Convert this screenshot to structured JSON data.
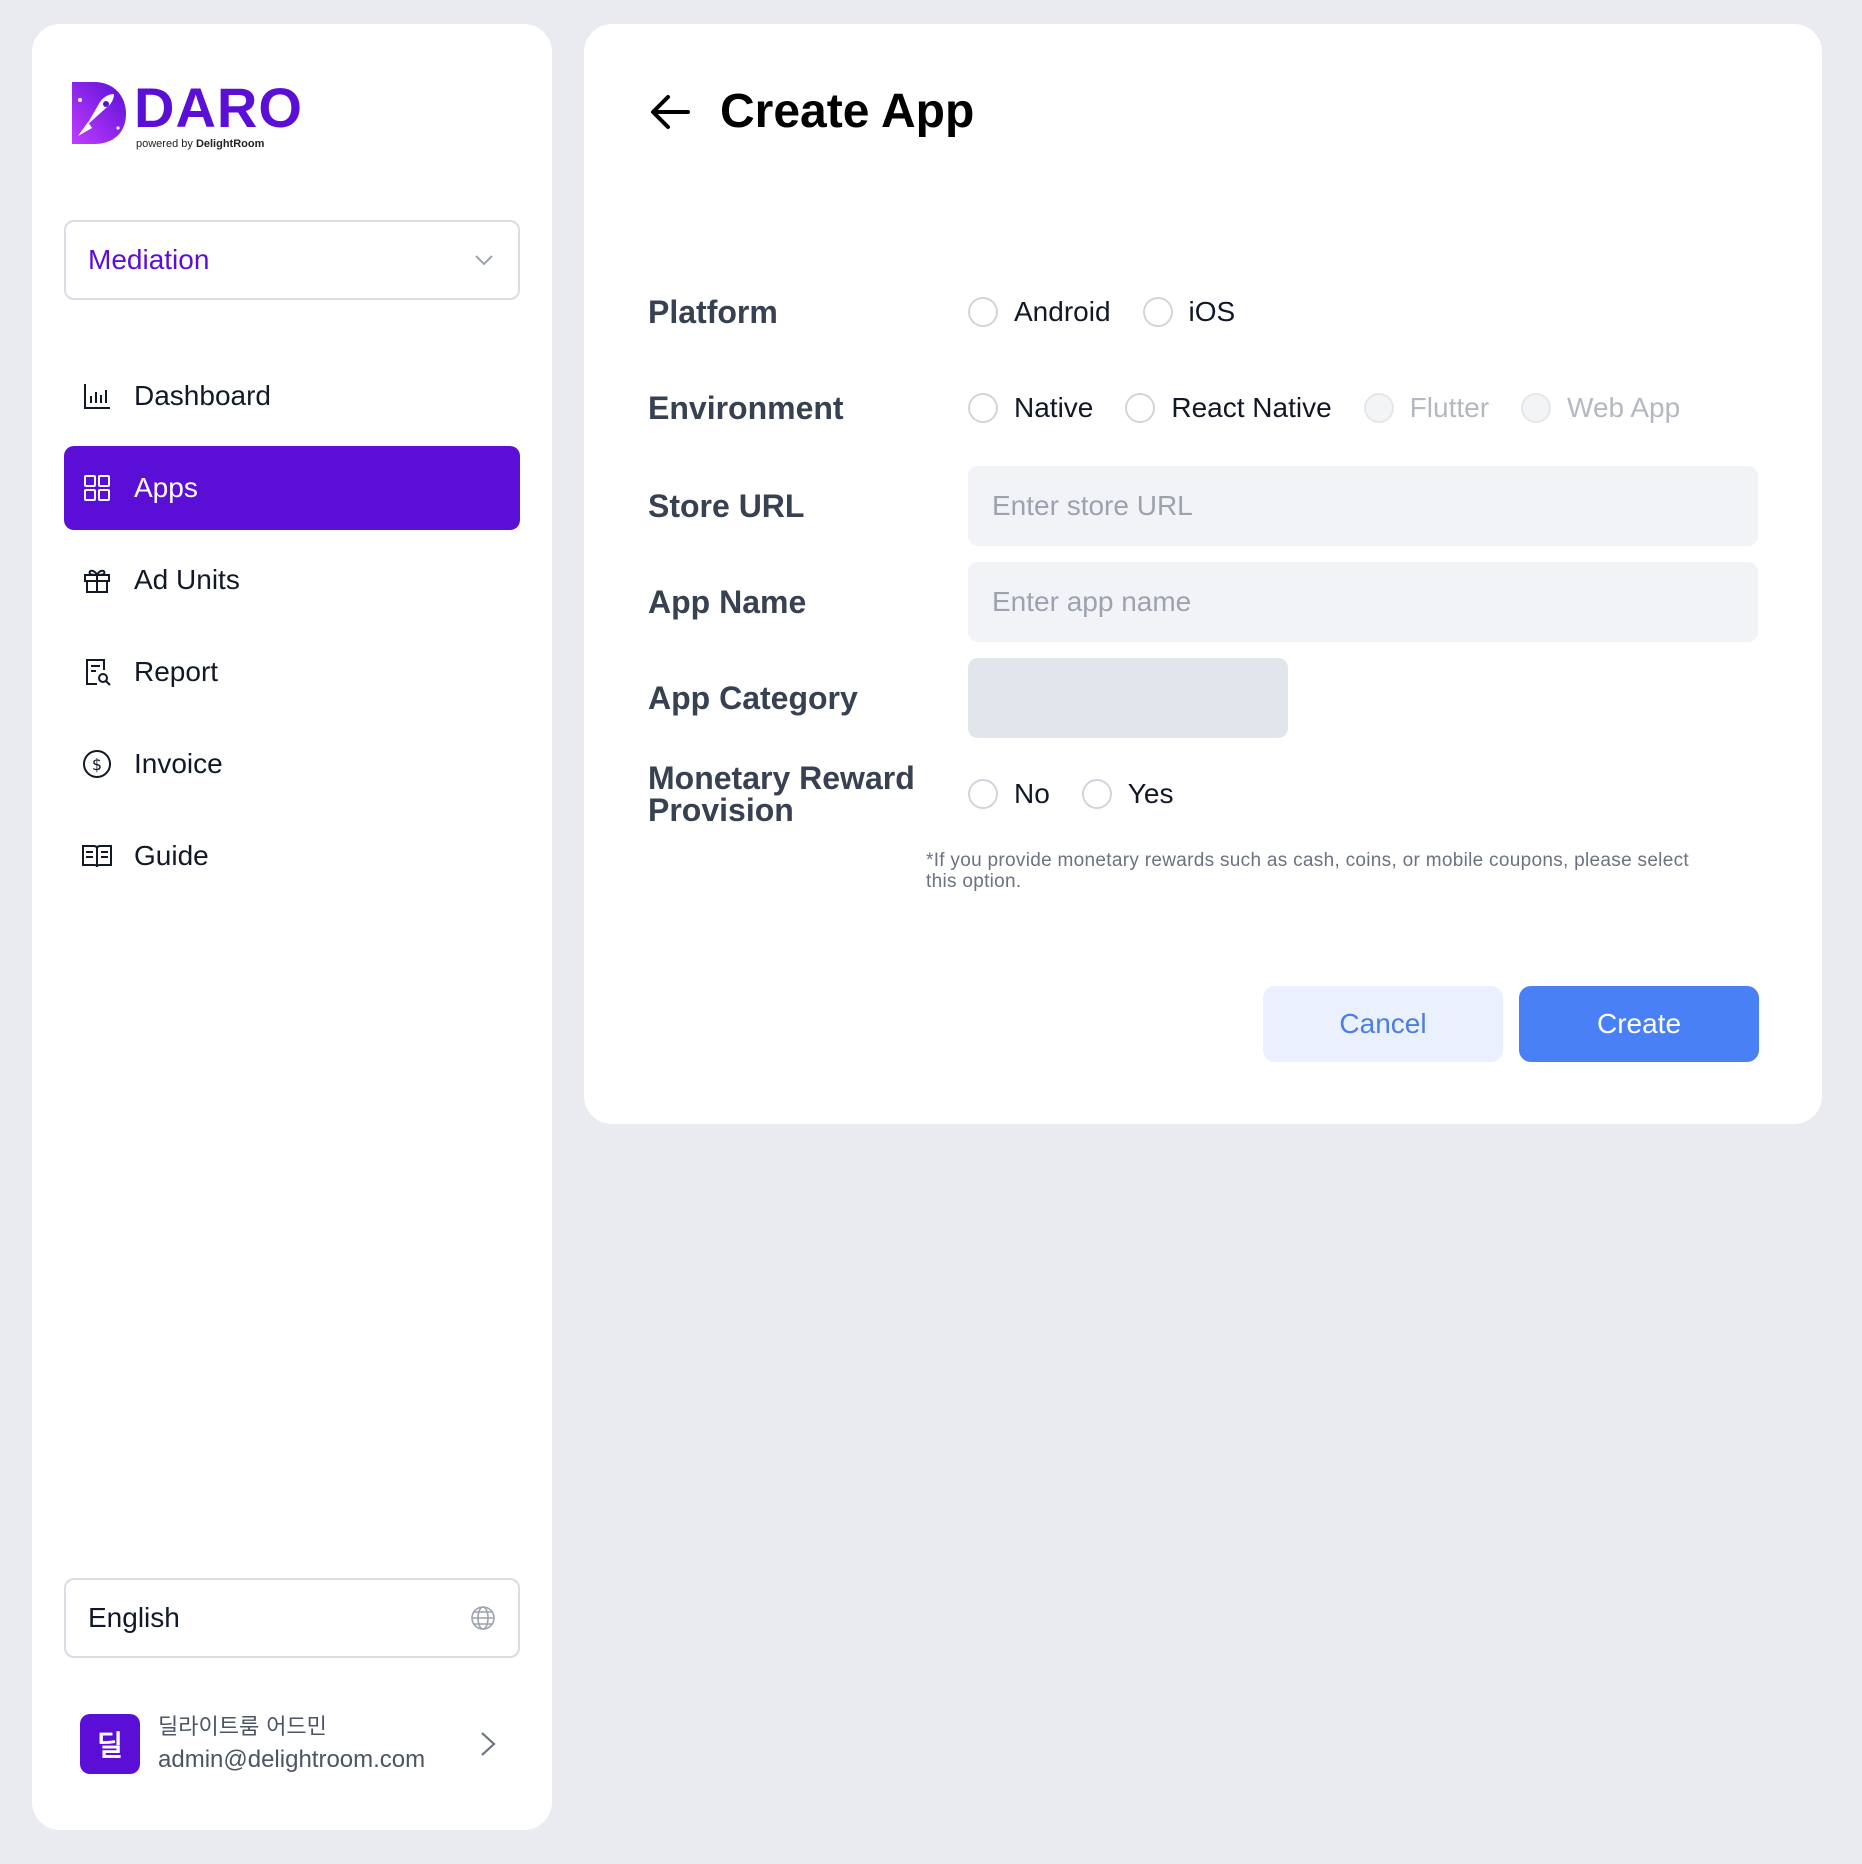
{
  "brand": {
    "name": "DARO",
    "tagline_prefix": "powered by",
    "tagline_company": "DelightRoom",
    "color": "#5b0fd6"
  },
  "sidebar": {
    "product_select": {
      "value": "Mediation"
    },
    "nav": [
      {
        "label": "Dashboard",
        "icon": "bar-chart-icon",
        "active": false
      },
      {
        "label": "Apps",
        "icon": "grid-icon",
        "active": true
      },
      {
        "label": "Ad Units",
        "icon": "gift-icon",
        "active": false
      },
      {
        "label": "Report",
        "icon": "report-search-icon",
        "active": false
      },
      {
        "label": "Invoice",
        "icon": "dollar-circle-icon",
        "active": false
      },
      {
        "label": "Guide",
        "icon": "book-icon",
        "active": false
      }
    ],
    "language_select": {
      "value": "English",
      "icon": "globe-icon"
    },
    "user": {
      "avatar_char": "딜",
      "name": "딜라이트룸 어드민",
      "email": "admin@delightroom.com"
    }
  },
  "page": {
    "title": "Create App",
    "form": {
      "platform": {
        "label": "Platform",
        "options": [
          "Android",
          "iOS"
        ]
      },
      "environment": {
        "label": "Environment",
        "options": [
          {
            "label": "Native",
            "disabled": false
          },
          {
            "label": "React Native",
            "disabled": false
          },
          {
            "label": "Flutter",
            "disabled": true
          },
          {
            "label": "Web App",
            "disabled": true
          }
        ]
      },
      "store_url": {
        "label": "Store URL",
        "placeholder": "Enter store URL",
        "value": ""
      },
      "app_name": {
        "label": "App Name",
        "placeholder": "Enter app name",
        "value": ""
      },
      "app_category": {
        "label": "App Category"
      },
      "monetary_reward": {
        "label_line1": "Monetary Reward",
        "label_line2": "Provision",
        "options": [
          "No",
          "Yes"
        ],
        "note": "*If you provide monetary rewards such as cash, coins, or mobile coupons, please select this option."
      }
    },
    "actions": {
      "cancel": "Cancel",
      "create": "Create"
    }
  },
  "colors": {
    "primary": "#5b0fd6",
    "button_blue": "#4a80f5",
    "cancel_bg": "#eaf0fe",
    "page_bg": "#e9ebf0"
  }
}
